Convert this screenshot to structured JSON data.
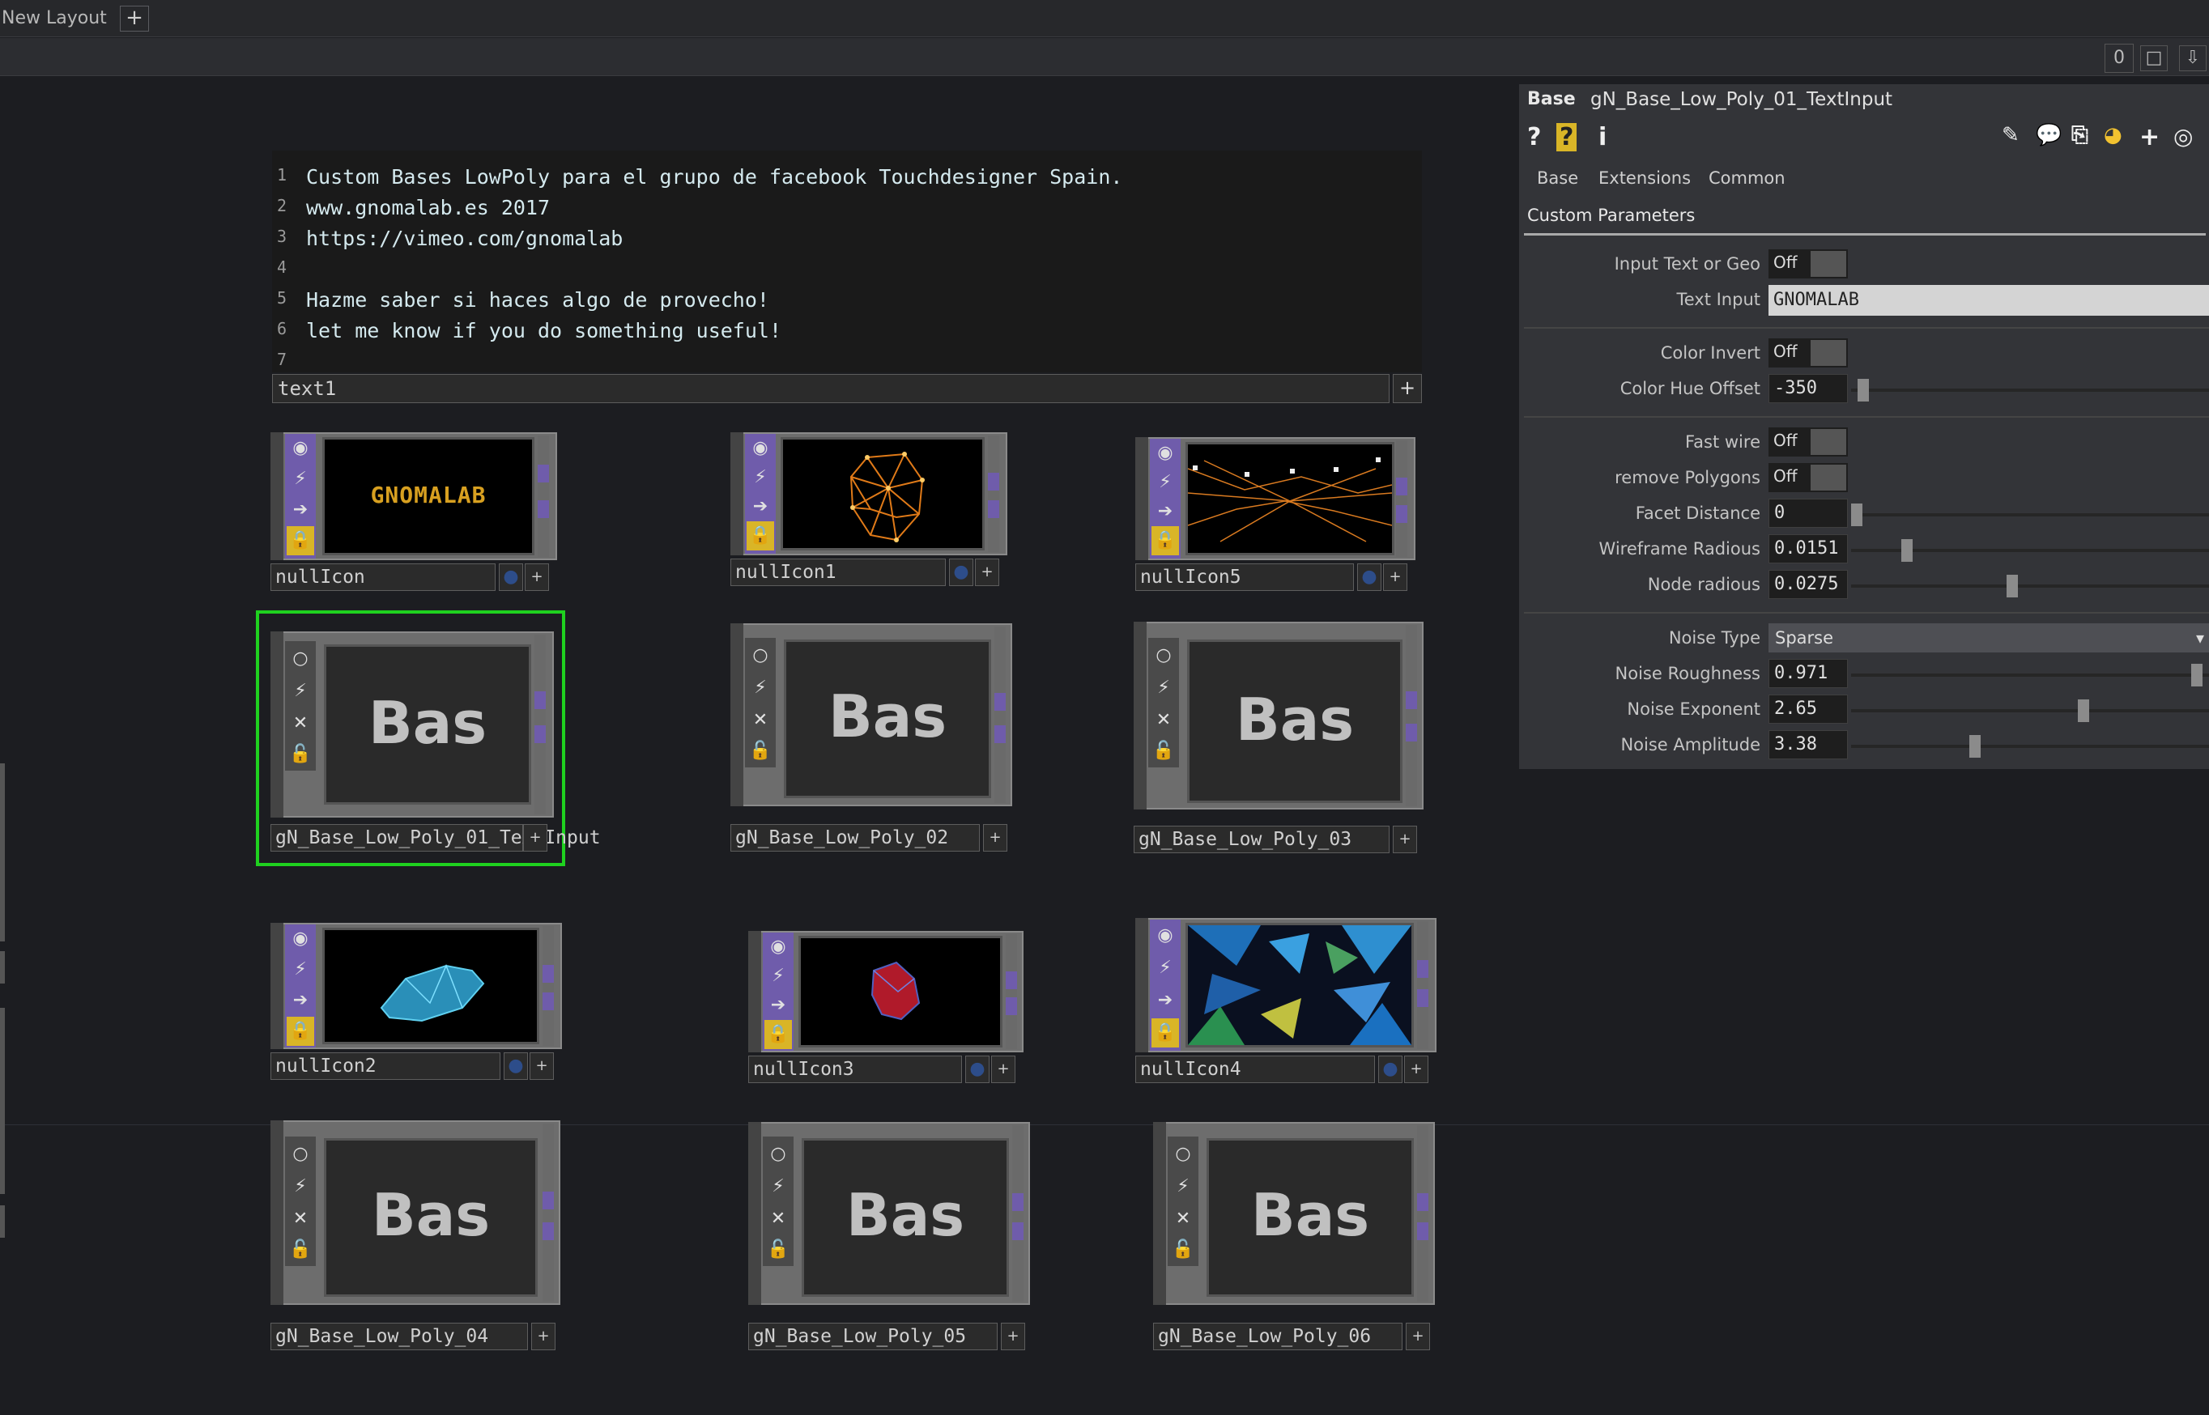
{
  "topbar": {
    "layout_label": "New Layout",
    "add_label": "+"
  },
  "toolbar": {
    "count": "0",
    "window_icon": "□",
    "down_icon": "⇩"
  },
  "text_dat": {
    "lines": [
      {
        "num": "1",
        "text": "Custom Bases LowPoly para el grupo de facebook Touchdesigner Spain."
      },
      {
        "num": "2",
        "text": "www.gnomalab.es 2017"
      },
      {
        "num": "3",
        "text": "https://vimeo.com/gnomalab"
      },
      {
        "num": "4",
        "text": ""
      },
      {
        "num": "5",
        "text": "Hazme saber si haces algo de provecho!"
      },
      {
        "num": "6",
        "text": "let me know if you do something useful!"
      },
      {
        "num": "7",
        "text": ""
      }
    ],
    "name": "text1",
    "button": "+"
  },
  "nodes": {
    "nullIcon": {
      "name": "nullIcon",
      "logo": "GNOMALAB"
    },
    "nullIcon1": {
      "name": "nullIcon1"
    },
    "nullIcon5": {
      "name": "nullIcon5"
    },
    "base01": {
      "name": "gN_Base_Low_Poly_01_TextInput",
      "label": "Bas"
    },
    "base02": {
      "name": "gN_Base_Low_Poly_02",
      "label": "Bas"
    },
    "base03": {
      "name": "gN_Base_Low_Poly_03",
      "label": "Bas"
    },
    "nullIcon2": {
      "name": "nullIcon2"
    },
    "nullIcon3": {
      "name": "nullIcon3"
    },
    "nullIcon4": {
      "name": "nullIcon4"
    },
    "base04": {
      "name": "gN_Base_Low_Poly_04",
      "label": "Bas"
    },
    "base05": {
      "name": "gN_Base_Low_Poly_05",
      "label": "Bas"
    },
    "base06": {
      "name": "gN_Base_Low_Poly_06",
      "label": "Bas"
    },
    "btn": "+",
    "dot": "●"
  },
  "panel": {
    "op_type": "Base",
    "op_path": "gN_Base_Low_Poly_01_TextInput",
    "icons": {
      "help": "?",
      "help_alt": "?",
      "info": "i",
      "add": "+"
    },
    "tabs": [
      "Base",
      "Extensions",
      "Common"
    ],
    "page": "Custom Parameters",
    "params": {
      "input_text_or_geo": {
        "label": "Input Text or Geo",
        "value": "Off"
      },
      "text_input": {
        "label": "Text Input",
        "value": "GNOMALAB"
      },
      "color_invert": {
        "label": "Color Invert",
        "value": "Off"
      },
      "color_hue_offset": {
        "label": "Color Hue Offset",
        "value": "-350"
      },
      "fast_wire": {
        "label": "Fast wire",
        "value": "Off"
      },
      "remove_polygons": {
        "label": "remove Polygons",
        "value": "Off"
      },
      "facet_distance": {
        "label": "Facet Distance",
        "value": "0"
      },
      "wireframe_radious": {
        "label": "Wireframe Radious",
        "value": "0.0151"
      },
      "node_radious": {
        "label": "Node radious",
        "value": "0.0275"
      },
      "noise_type": {
        "label": "Noise Type",
        "value": "Sparse"
      },
      "noise_roughness": {
        "label": "Noise Roughness",
        "value": "0.971"
      },
      "noise_exponent": {
        "label": "Noise Exponent",
        "value": "2.65"
      },
      "noise_amplitude": {
        "label": "Noise Amplitude",
        "value": "3.38"
      }
    }
  },
  "colors": {
    "selection": "#1fd11f",
    "flag_purple": "#6f5cab",
    "lock_yellow": "#d9b527",
    "code_text": "#d4e9ee"
  }
}
